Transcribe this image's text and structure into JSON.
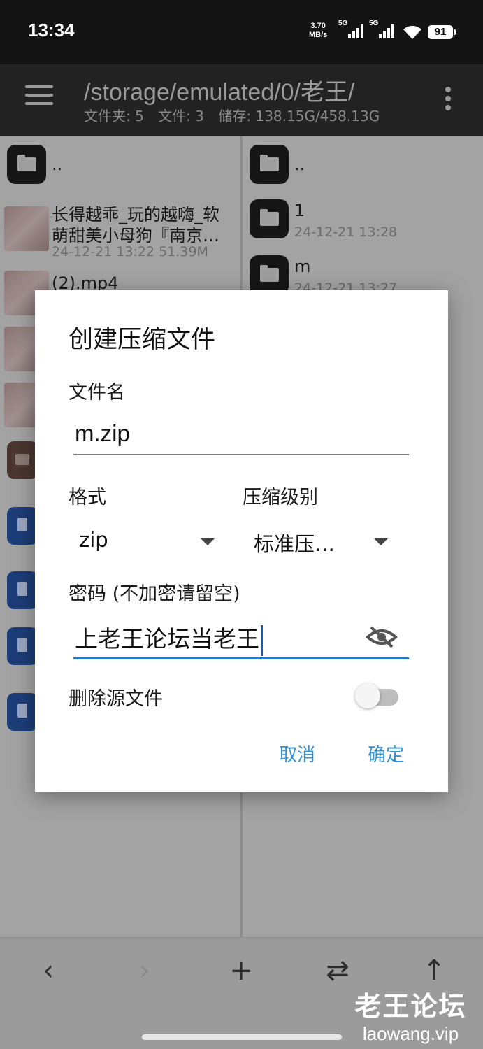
{
  "status_bar": {
    "time": "13:34",
    "net_speed_value": "3.70",
    "net_speed_unit": "MB/s",
    "signal1_label": "5G",
    "signal2_label": "5G",
    "battery": "91"
  },
  "header": {
    "path": "/storage/emulated/0/老王/",
    "folders": "文件夹: 5",
    "files": "文件: 3",
    "storage": "储存: 138.15G/458.13G"
  },
  "left_panel": {
    "parent": "..",
    "items": [
      {
        "name_line1": "长得越乖_玩的越嗨_软",
        "name_line2": "萌甜美小母狗『南京…",
        "meta": "24-12-21 13:22  51.39M"
      },
      {
        "name_line1": "(2).mp4"
      }
    ]
  },
  "right_panel": {
    "parent": "..",
    "items": [
      {
        "name": "1",
        "meta": "24-12-21 13:28"
      },
      {
        "name": "m",
        "meta": "24-12-21 13:27"
      }
    ]
  },
  "dialog": {
    "title": "创建压缩文件",
    "filename_label": "文件名",
    "filename_value": "m.zip",
    "format_label": "格式",
    "format_value": "zip",
    "level_label": "压缩级别",
    "level_value": "标准压…",
    "password_label": "密码 (不加密请留空)",
    "password_value": "上老王论坛当老王",
    "delete_source_label": "删除源文件",
    "delete_source_on": false,
    "cancel": "取消",
    "confirm": "确定"
  },
  "bottom_bar": {
    "back": "‹",
    "forward": "›",
    "add": "+",
    "swap": "⇄",
    "up": "↑"
  },
  "watermark": {
    "line1": "老王论坛",
    "line2": "laowang.vip"
  }
}
